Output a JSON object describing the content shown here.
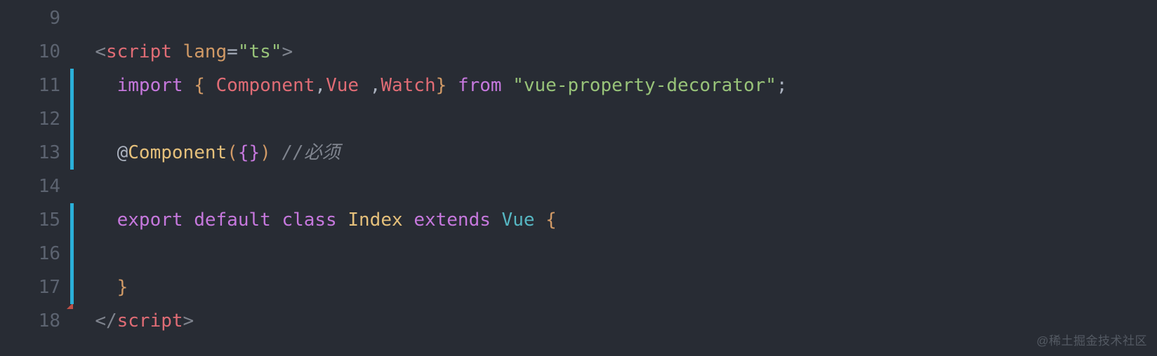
{
  "startLine": 9,
  "watermark": "@稀土掘金技术社区",
  "tokens": {
    "l10": {
      "pad": "  ",
      "lt": "<",
      "tag": "script",
      "sp": " ",
      "attr": "lang",
      "eq": "=",
      "q1": "\"",
      "str": "ts",
      "q2": "\"",
      "gt": ">"
    },
    "l11": {
      "pad": "    ",
      "import": "import",
      "sp1": " ",
      "lbrace": "{",
      "sp2": " ",
      "comp": "Component",
      "c1": ",",
      "vue": "Vue",
      "sp3": " ",
      "c2": ",",
      "watch": "Watch",
      "rbrace": "}",
      "sp4": " ",
      "from": "from",
      "sp5": " ",
      "q1": "\"",
      "pkg": "vue-property-decorator",
      "q2": "\"",
      "semi": ";"
    },
    "l13": {
      "pad": "    ",
      "at": "@",
      "decor": "Component",
      "lp": "(",
      "lbrace": "{",
      "rbrace": "}",
      "rp": ")",
      "sp": " ",
      "comment": "//必须"
    },
    "l15": {
      "pad": "    ",
      "export": "export",
      "sp1": " ",
      "default": "default",
      "sp2": " ",
      "class": "class",
      "sp3": " ",
      "name": "Index",
      "sp4": " ",
      "extends": "extends",
      "sp5": " ",
      "super": "Vue",
      "sp6": " ",
      "lbrace": "{"
    },
    "l17": {
      "pad": "    ",
      "rbrace": "}"
    },
    "l18": {
      "pad": "  ",
      "lt": "</",
      "tag": "script",
      "gt": ">"
    }
  }
}
